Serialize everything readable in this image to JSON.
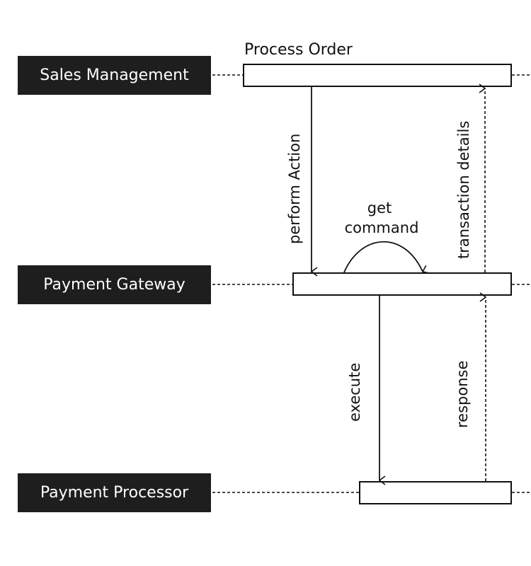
{
  "diagram": {
    "type": "sequence",
    "lanes": [
      {
        "id": "sales",
        "label": "Sales Management"
      },
      {
        "id": "gateway",
        "label": "Payment Gateway"
      },
      {
        "id": "processor",
        "label": "Payment Processor"
      }
    ],
    "activations": [
      {
        "lane": "sales",
        "label": "Process Order"
      },
      {
        "lane": "gateway",
        "label": ""
      },
      {
        "lane": "processor",
        "label": ""
      }
    ],
    "messages": [
      {
        "from": "sales",
        "to": "gateway",
        "label": "perform Action",
        "style": "solid"
      },
      {
        "from": "gateway",
        "to": "gateway",
        "label_line1": "get",
        "label_line2": "command",
        "style": "solid-self"
      },
      {
        "from": "gateway",
        "to": "sales",
        "label": "transaction details",
        "style": "dashed-return"
      },
      {
        "from": "gateway",
        "to": "processor",
        "label": "execute",
        "style": "solid"
      },
      {
        "from": "processor",
        "to": "gateway",
        "label": "response",
        "style": "dashed-return"
      }
    ],
    "colors": {
      "lane_bg": "#1e1e1e",
      "lane_text": "#ffffff",
      "line": "#111111"
    }
  }
}
